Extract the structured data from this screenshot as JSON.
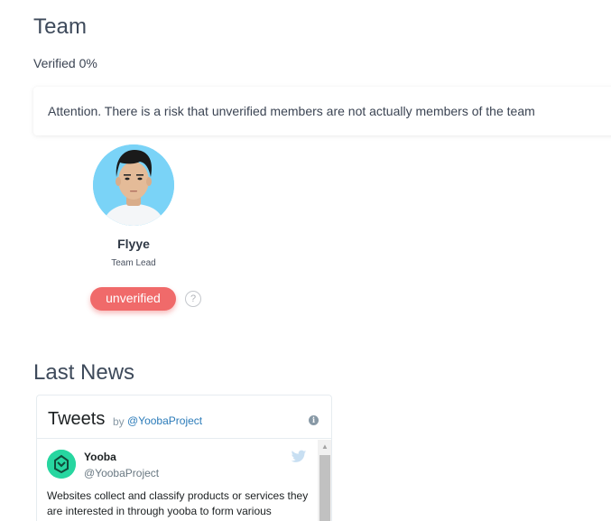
{
  "team": {
    "title": "Team",
    "verified_text": "Verified 0%",
    "attention": "Attention. There is a risk that unverified members are not actually members of the team",
    "members": [
      {
        "name": "Flyye",
        "role": "Team Lead",
        "status": "unverified",
        "status_color": "#f06a6a",
        "help_glyph": "?"
      }
    ]
  },
  "news": {
    "title": "Last News",
    "widget": {
      "title": "Tweets",
      "by": "by",
      "handle": "@YoobaProject",
      "info_glyph": "i",
      "tweets": [
        {
          "name": "Yooba",
          "username": "@YoobaProject",
          "text": "Websites collect and classify products or services they are interested in through yooba to form various"
        }
      ],
      "scroll_up_glyph": "▲"
    }
  },
  "icons": {
    "help": "question-circle-icon",
    "info": "info-circle-icon",
    "twitter": "twitter-bird-icon",
    "scroll": "scroll-up-arrow-icon"
  },
  "colors": {
    "heading": "#3e4a5b",
    "unverified": "#f06a6a",
    "twitter_link": "#2b7bb9",
    "brand_avatar": "#27d6a0"
  }
}
